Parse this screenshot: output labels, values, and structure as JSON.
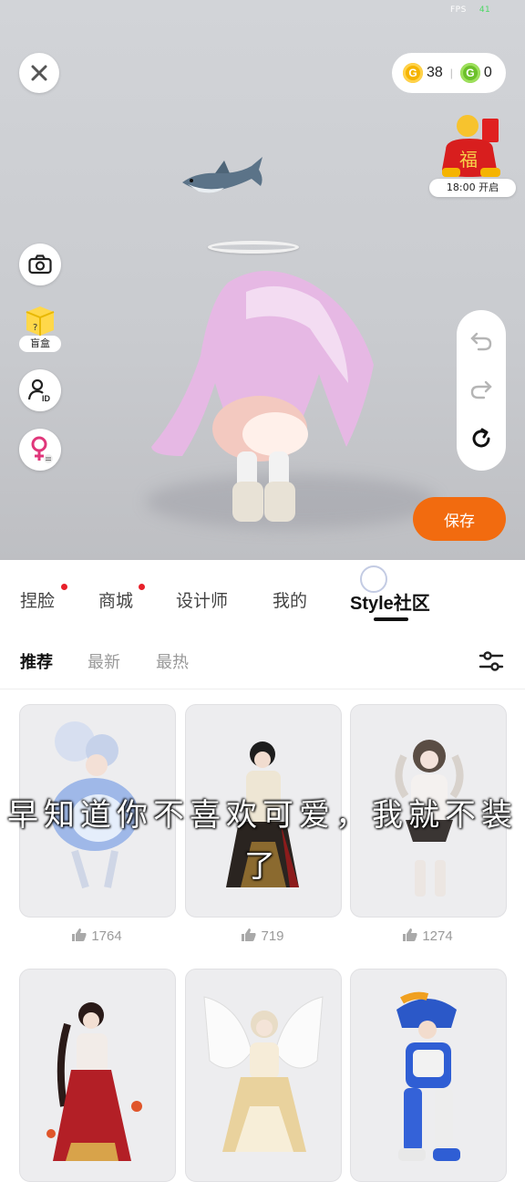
{
  "status": {
    "fps_label": "FPS",
    "fps_value": "41"
  },
  "currency": {
    "gold": "38",
    "green": "0"
  },
  "lucky_bag": {
    "char": "福",
    "time_label": "18:00 开启"
  },
  "side": {
    "blindbox_label": "盲盒",
    "blindbox_mark": "?"
  },
  "save_label": "保存",
  "tabs": [
    {
      "label": "捏脸",
      "dot": true
    },
    {
      "label": "商城",
      "dot": true
    },
    {
      "label": "设计师",
      "dot": false
    },
    {
      "label": "我的",
      "dot": false
    },
    {
      "label": "Style社区",
      "dot": false,
      "active": true
    }
  ],
  "subtabs": [
    {
      "label": "推荐",
      "active": true
    },
    {
      "label": "最新"
    },
    {
      "label": "最热"
    }
  ],
  "cards": [
    {
      "likes": "1764"
    },
    {
      "likes": "719"
    },
    {
      "likes": "1274"
    },
    {
      "likes": ""
    },
    {
      "likes": ""
    },
    {
      "likes": ""
    }
  ],
  "subtitle": {
    "line1": "早知道你不喜欢可爱，我就不装",
    "line2": "了"
  },
  "colors": {
    "accent": "#f26b0f",
    "dot": "#e8202a",
    "gold_coin": "#f5b400",
    "green_coin": "#6cc02a"
  }
}
